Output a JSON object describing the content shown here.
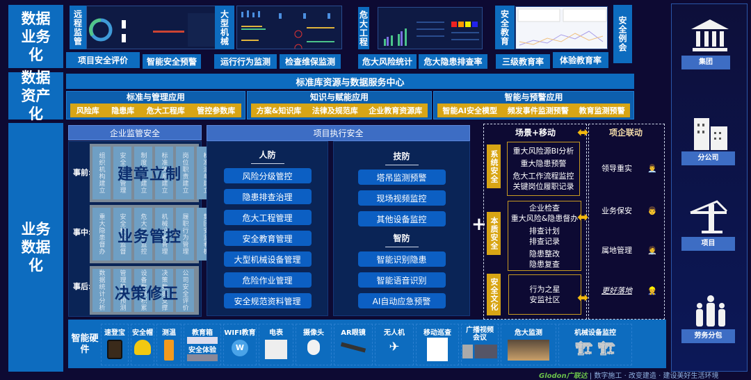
{
  "layers": {
    "business": "数据业务化",
    "asset": "数据资产化",
    "data": "业务数据化"
  },
  "top_modules": [
    {
      "label": "远程监管"
    },
    {
      "label": "大型机械"
    },
    {
      "label": "危大工程"
    },
    {
      "label": "安全教育"
    },
    {
      "label": "安全例会"
    }
  ],
  "top_buttons": [
    "项目安全评价",
    "智能安全预警",
    "运行行为监测",
    "检查维保监测",
    "危大风险统计",
    "危大隐患排查率",
    "三级教育率",
    "体验教育率"
  ],
  "asset": {
    "center": "标准库资源与数据服务中心",
    "groups": [
      {
        "title": "标准与管理应用",
        "items": [
          "风险库",
          "隐患库",
          "危大工程库",
          "管控参数库"
        ]
      },
      {
        "title": "知识与赋能应用",
        "items": [
          "方案&知识库",
          "法律及规范库",
          "企业教育资源库"
        ]
      },
      {
        "title": "智能与预警应用",
        "items": [
          "智能AI安全模型",
          "频发事件监测预警",
          "教育监测预警"
        ]
      }
    ]
  },
  "enterprise": {
    "title": "企业监管安全",
    "rows": [
      {
        "label": "事前:",
        "overlay": "建章立制",
        "cols": [
          "组织机构建立",
          "安全生产管理",
          "制度体系建立",
          "标准体系建立",
          "岗位职责建立",
          "标准清单建立"
        ]
      },
      {
        "label": "事中:",
        "overlay": "业务管控",
        "cols": [
          "重大隐患督办",
          "安全检查监督",
          "危大工程监控",
          "机械设备管理",
          "履职行为管理",
          "集团安监看板"
        ]
      },
      {
        "label": "事后:",
        "overlay": "决策修正",
        "cols": [
          "数据统计分析",
          "管理趋势预测",
          "设备数据积累",
          "决策数据支撑",
          "公司安全评价"
        ]
      }
    ]
  },
  "project": {
    "title": "项目执行安全",
    "people": {
      "title": "人防",
      "items": [
        "风险分级管控",
        "隐患排查治理",
        "危大工程管理",
        "安全教育管理",
        "大型机械设备管理",
        "危险作业管理",
        "安全规范资料管理"
      ]
    },
    "tech": {
      "title": "技防",
      "items": [
        "塔吊监测预警",
        "现场视频监控",
        "其他设备监控"
      ]
    },
    "smart": {
      "title": "智防",
      "items": [
        "智能识别隐患",
        "智能语音识别",
        "AI自动应急预警"
      ]
    }
  },
  "plus": "+",
  "scene": {
    "title": "场景+移动",
    "linkage_title": "项企联动",
    "groups": [
      {
        "tag": "系统安全",
        "lines": [
          "重大风险源BI分析",
          "重大隐患预警",
          "危大工作流程监控",
          "关键岗位履职记录"
        ]
      },
      {
        "tag": "本质安全",
        "lines": [
          "企业检查",
          "重大风险&隐患督办",
          "排查计划",
          "排查记录",
          "隐患整改",
          "隐患复查"
        ]
      },
      {
        "tag": "安全文化",
        "lines": [
          "行为之星",
          "安监社区"
        ]
      }
    ],
    "roles": [
      "领导重实",
      "业务保安",
      "属地管理",
      "更好落地"
    ]
  },
  "hardware": {
    "title": "智能硬件",
    "items": [
      "速登宝",
      "安全帽",
      "测温",
      "教育箱",
      "安全体验",
      "WIFI教育",
      "电表",
      "摄像头",
      "AR眼镜",
      "无人机",
      "移动巡查",
      "广播视频会议",
      "危大监测",
      "机械设备监控"
    ]
  },
  "tiers": [
    "集团",
    "分公司",
    "项目",
    "劳务分包"
  ],
  "footer": {
    "brand": "Glodon广联达",
    "slogan": "| 数字施工 · 改变建造 · 建设美好生活环境"
  },
  "colors": {
    "blue": "#0d6cbf",
    "gold": "#d8a515",
    "bg": "#0d0a33",
    "header": "#3d6dc4"
  }
}
